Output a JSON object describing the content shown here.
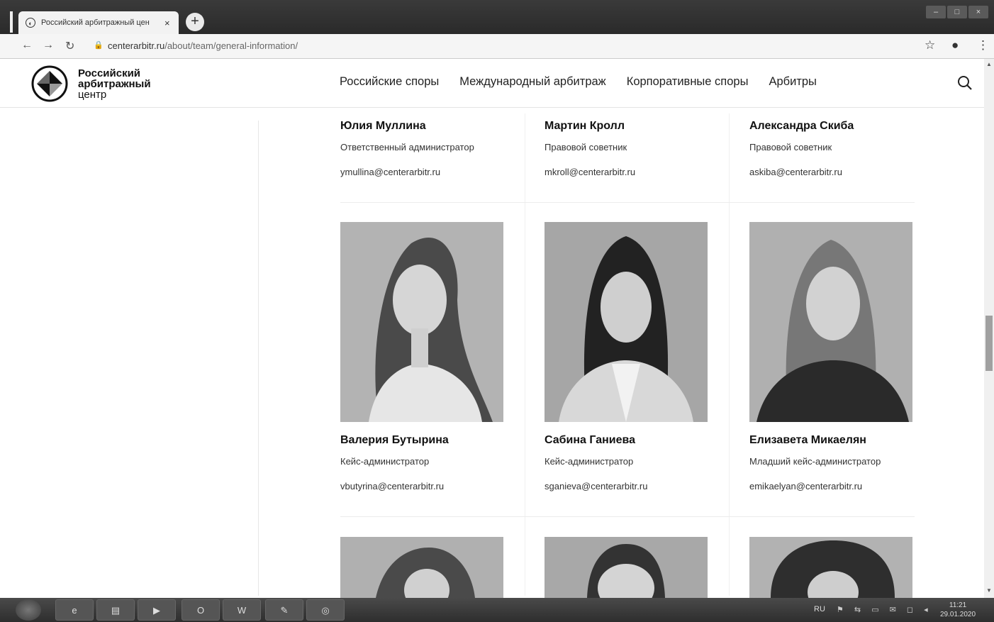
{
  "browser": {
    "tab_title": "Российский арбитражный цен",
    "tab_close": "×",
    "new_tab": "+",
    "url_host": "centerarbitr.ru",
    "url_path": "/about/team/general-information/",
    "window_buttons": [
      "–",
      "□",
      "×"
    ]
  },
  "site": {
    "logo_line1": "Российский",
    "logo_line2": "арбитражный",
    "logo_line3": "центр",
    "nav": [
      "Российские споры",
      "Международный арбитраж",
      "Корпоративные споры",
      "Арбитры"
    ]
  },
  "team_row1": [
    {
      "name": "Юлия Муллина",
      "role": "Ответственный администратор",
      "email": "ymullina@centerarbitr.ru"
    },
    {
      "name": "Мартин Кролл",
      "role": "Правовой советник",
      "email": "mkroll@centerarbitr.ru"
    },
    {
      "name": "Александра Скиба",
      "role": "Правовой советник",
      "email": "askiba@centerarbitr.ru"
    }
  ],
  "team_row2": [
    {
      "name": "Валерия Бутырина",
      "role": "Кейс-администратор",
      "email": "vbutyrina@centerarbitr.ru"
    },
    {
      "name": "Сабина Ганиева",
      "role": "Кейс-администратор",
      "email": "sganieva@centerarbitr.ru"
    },
    {
      "name": "Елизавета Микаелян",
      "role": "Младший кейс-администратор",
      "email": "emikaelyan@centerarbitr.ru"
    }
  ],
  "taskbar": {
    "lang": "RU",
    "time": "11:21",
    "date": "29.01.2020"
  }
}
